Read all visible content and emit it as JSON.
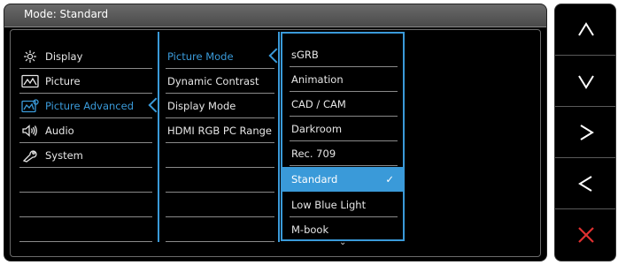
{
  "title": "Mode: Standard",
  "menu": [
    {
      "label": "Display",
      "icon": "display-icon"
    },
    {
      "label": "Picture",
      "icon": "picture-icon"
    },
    {
      "label": "Picture Advanced",
      "icon": "picture-advanced-icon"
    },
    {
      "label": "Audio",
      "icon": "audio-icon"
    },
    {
      "label": "System",
      "icon": "system-icon"
    }
  ],
  "submenu": [
    "Picture Mode",
    "Dynamic Contrast",
    "Display Mode",
    "HDMI RGB PC Range"
  ],
  "options": [
    "sGRB",
    "Animation",
    "CAD / CAM",
    "Darkroom",
    "Rec. 709",
    "Standard",
    "Low Blue Light",
    "M-book"
  ],
  "selected_option": "Standard",
  "active_menu": "Picture Advanced",
  "active_submenu": "Picture Mode",
  "check_mark": "✓",
  "more_glyph": "⌄",
  "keys": [
    "up-icon",
    "down-icon",
    "right-icon",
    "left-icon",
    "close-icon"
  ],
  "colors": {
    "accent": "#3a9ad9",
    "close": "#e03030",
    "background": "#000000",
    "text": "#e6e6e6"
  }
}
